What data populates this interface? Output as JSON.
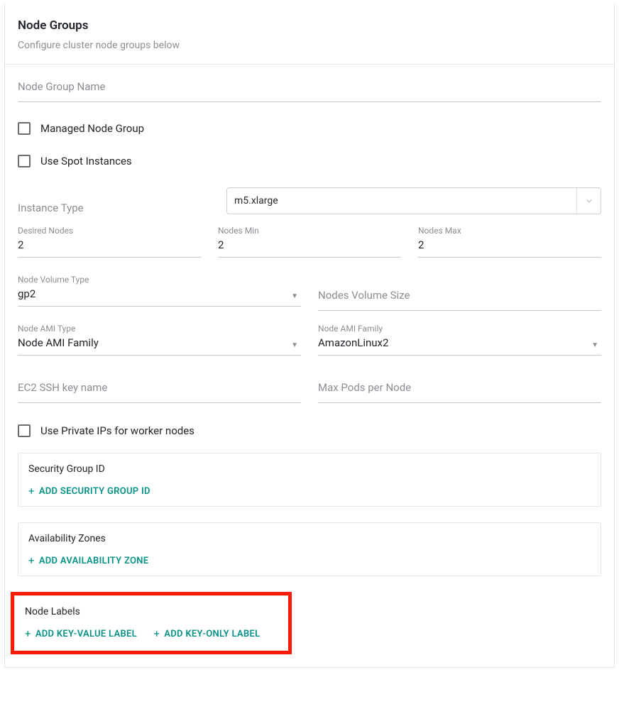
{
  "header": {
    "title": "Node Groups",
    "subtitle": "Configure cluster node groups below"
  },
  "fields": {
    "node_group_name": {
      "placeholder": "Node Group Name",
      "value": ""
    },
    "managed_node_group": {
      "label": "Managed Node Group",
      "checked": false
    },
    "use_spot_instances": {
      "label": "Use Spot Instances",
      "checked": false
    },
    "instance_type": {
      "label": "Instance Type",
      "value": "m5.xlarge"
    },
    "desired_nodes": {
      "label": "Desired Nodes",
      "value": "2"
    },
    "nodes_min": {
      "label": "Nodes Min",
      "value": "2"
    },
    "nodes_max": {
      "label": "Nodes Max",
      "value": "2"
    },
    "node_volume_type": {
      "label": "Node Volume Type",
      "value": "gp2"
    },
    "nodes_volume_size": {
      "placeholder": "Nodes Volume Size",
      "value": ""
    },
    "node_ami_type": {
      "label": "Node AMI Type",
      "value": "Node AMI Family"
    },
    "node_ami_family": {
      "label": "Node AMI Family",
      "value": "AmazonLinux2"
    },
    "ec2_ssh_key": {
      "placeholder": "EC2 SSH key name",
      "value": ""
    },
    "max_pods": {
      "placeholder": "Max Pods per Node",
      "value": ""
    },
    "use_private_ips": {
      "label": "Use Private IPs for worker nodes",
      "checked": false
    }
  },
  "cards": {
    "security_group": {
      "title": "Security Group ID",
      "add_label": "ADD  SECURITY GROUP ID"
    },
    "availability_zones": {
      "title": "Availability Zones",
      "add_label": "ADD  AVAILABILITY ZONE"
    },
    "node_labels": {
      "title": "Node Labels",
      "add_kv_label": "ADD KEY-VALUE LABEL",
      "add_k_label": "ADD KEY-ONLY LABEL"
    }
  }
}
